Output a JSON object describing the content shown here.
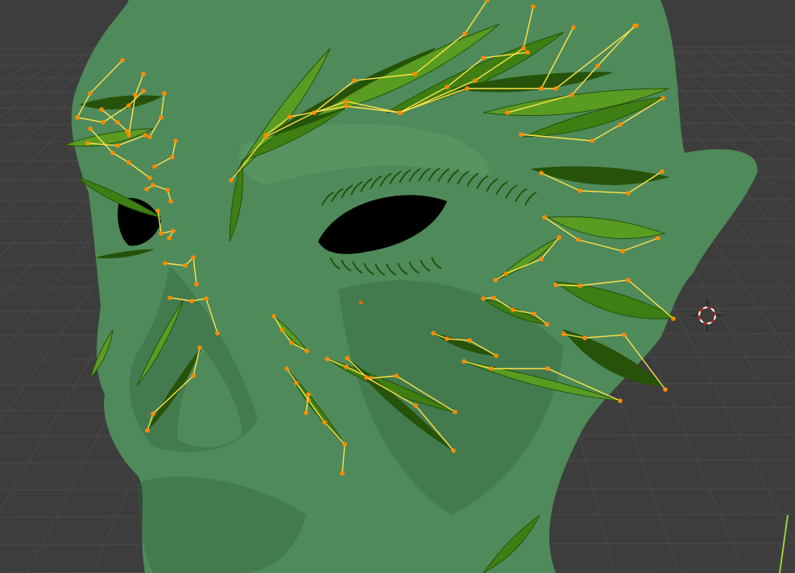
{
  "viewport": {
    "background": "#3d3d3d",
    "grid_color": "#4a4a4a",
    "grid_axis_color": "#9bd03a"
  },
  "model": {
    "skin_color": "#4f8a5a",
    "skin_shadow": "#2f5e3b",
    "skin_highlight": "#6aa673",
    "leaf_color": "#3f7e12",
    "leaf_dark": "#265309",
    "leaf_light": "#5a9c22",
    "eye_socket_color": "#000000"
  },
  "curves": {
    "stroke_color": "#ffe24a",
    "point_color": "#ff8c00",
    "origin_color": "#e07000"
  },
  "cursor_3d": {
    "icon": "3d-cursor-icon",
    "ring_color_a": "#ffffff",
    "ring_color_b": "#d22020",
    "crosshair_color": "#222222"
  }
}
